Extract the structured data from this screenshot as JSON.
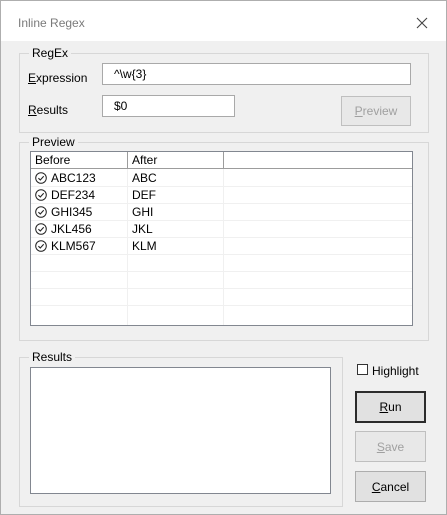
{
  "window": {
    "title": "Inline Regex",
    "close_icon": "close-icon"
  },
  "regex_group": {
    "label": "RegEx",
    "expression_label_prefix": "E",
    "expression_label_rest": "xpression",
    "expression_value": "^\\w{3}",
    "results_label_prefix": "R",
    "results_label_rest": "esults",
    "results_value": "$0",
    "preview_button_prefix": "P",
    "preview_button_rest": "review",
    "preview_button_enabled": false
  },
  "preview_group": {
    "label": "Preview",
    "columns": [
      "Before",
      "After"
    ],
    "rows": [
      {
        "status_icon": "check-circle-icon",
        "before": "ABC123",
        "after": "ABC"
      },
      {
        "status_icon": "check-circle-icon",
        "before": "DEF234",
        "after": "DEF"
      },
      {
        "status_icon": "check-circle-icon",
        "before": "GHI345",
        "after": "GHI"
      },
      {
        "status_icon": "check-circle-icon",
        "before": "JKL456",
        "after": "JKL"
      },
      {
        "status_icon": "check-circle-icon",
        "before": "KLM567",
        "after": "KLM"
      }
    ]
  },
  "results_group": {
    "label": "Results",
    "value": ""
  },
  "highlight": {
    "label": "Highlight",
    "checked": false
  },
  "buttons": {
    "run_prefix": "R",
    "run_rest": "un",
    "save_prefix": "S",
    "save_rest": "ave",
    "save_enabled": false,
    "cancel_prefix": "C",
    "cancel_rest": "ancel"
  },
  "colors": {
    "dialog_bg": "#f0f0f0",
    "titlebar_bg": "#ffffff",
    "disabled_text": "#a0a0a0",
    "spreadsheet_grid": "#d6d6d6"
  }
}
